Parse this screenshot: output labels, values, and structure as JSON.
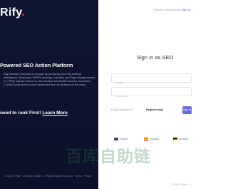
{
  "brand": {
    "logo_main": "Rify",
    "logo_dot": "."
  },
  "hero": {
    "headline": "Powered SEO Action Platform",
    "description": "Rify websites that rank on Google by just giving one Rify Artificial Intelligence. Boost your SERPs rankings, real-time and Page Display thanks to CTRify organic Actions of real Desktop and Mobile devices connected, CTRify's tools all from your Dashboard from all locations of the world.",
    "cta_text": "need to rank First!",
    "cta_link": "Learn More"
  },
  "left_footer": "© 2024 CTRify · CTRify Ai Institute · CTRify All Rights Reserved · Terms · Privacy",
  "topbar": {
    "prompt": "Register new account",
    "link": "Sign In"
  },
  "form": {
    "title": "Sign In as SEO",
    "email_placeholder": "Email",
    "password_placeholder": "Password",
    "forgot": "Forgot Password?",
    "register": "Register Now",
    "submit": "Sign In"
  },
  "languages": [
    {
      "label": "English",
      "flag": "flag-en"
    },
    {
      "label": "Español",
      "flag": "flag-es"
    },
    {
      "label": "Deutsch",
      "flag": "flag-de"
    }
  ],
  "right_footer": "© 2024 CTRify · Ir",
  "watermark": "百库自助链",
  "colors": {
    "panel": "#0f1631",
    "accent": "#6b6be0",
    "logo_dot": "#e8333c"
  }
}
